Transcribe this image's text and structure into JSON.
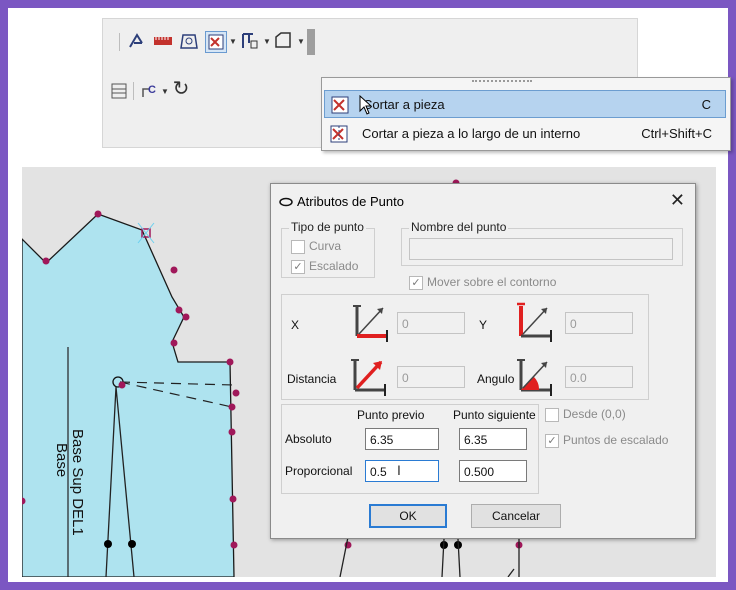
{
  "menu": {
    "items": [
      {
        "label": "Cortar a pieza",
        "shortcut": "C",
        "icon": "cut-piece-icon"
      },
      {
        "label": "Cortar a pieza a lo largo de un interno",
        "shortcut": "Ctrl+Shift+C",
        "icon": "cut-piece-internal-icon"
      }
    ]
  },
  "canvas": {
    "piece_labels": [
      "Base Sup DEL1",
      "Base"
    ]
  },
  "dialog": {
    "title": "Atributos de Punto",
    "tipo_group": "Tipo de punto",
    "curva_label": "Curva",
    "curva_checked": false,
    "escalado_label": "Escalado",
    "escalado_checked": true,
    "nombre_group": "Nombre del punto",
    "nombre_value": "",
    "mover_label": "Mover sobre el contorno",
    "mover_checked": true,
    "x_label": "X",
    "x_value": "0",
    "y_label": "Y",
    "y_value": "0",
    "distancia_label": "Distancia",
    "distancia_value": "0",
    "angulo_label": "Angulo",
    "angulo_value": "0.0",
    "punto_previo_header": "Punto previo",
    "punto_siguiente_header": "Punto siguiente",
    "absoluto_label": "Absoluto",
    "absoluto_prev": "6.35",
    "absoluto_next": "6.35",
    "proporcional_label": "Proporcional",
    "proporcional_prev": "0.5",
    "proporcional_next": "0.500",
    "desde_label": "Desde (0,0)",
    "desde_checked": false,
    "puntos_escalado_label": "Puntos de escalado",
    "puntos_escalado_checked": true,
    "ok_label": "OK",
    "cancel_label": "Cancelar"
  },
  "colors": {
    "frame": "#7b57c2",
    "piece_fill": "#aee3ef",
    "point": "#a0185a",
    "menu_highlight": "#b6d3ef",
    "arrow_red": "#e02020"
  }
}
